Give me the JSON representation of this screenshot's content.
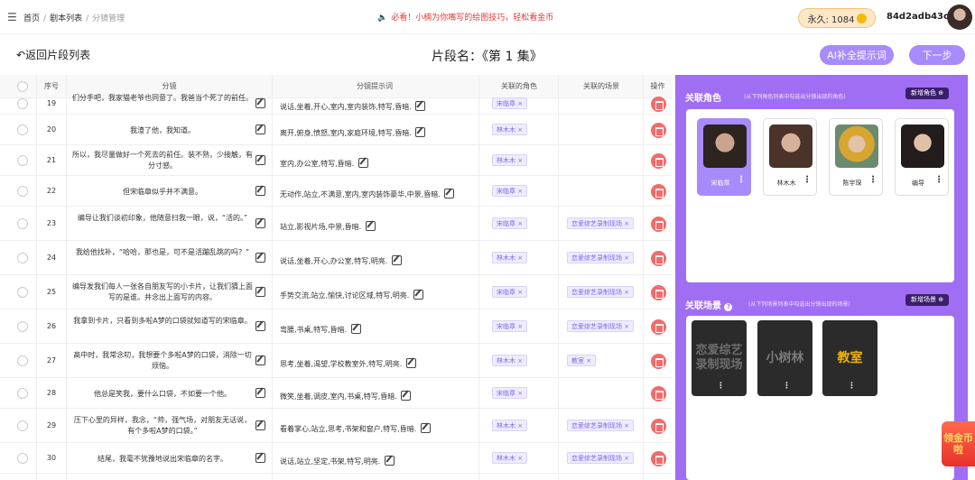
{
  "topbar": {
    "breadcrumbs": [
      "首页",
      "剧本列表",
      "分镜管理"
    ],
    "notice": "必看！小楠为你嘴写的绘图技巧，轻松看金币",
    "coins_label": "永久: 1084",
    "username": "84d2adb43c26"
  },
  "header": {
    "back_label": "返回片段列表",
    "episode_title": "片段名：《第 1 集》",
    "ai_button": "AI补全提示词",
    "next_button": "下一步"
  },
  "table": {
    "columns": [
      "序号",
      "分镜",
      "分镜提示词",
      "关联的角色",
      "关联的场景",
      "操作"
    ],
    "rows": [
      {
        "no": "19",
        "shot": "们分手吧，我家猫老爷也同意了。我爸当个死了的前任。",
        "prompt": "说话,坐着,开心,室内,室内装饰,特写,昏暗.",
        "role": "宋临章 ×",
        "scene": ""
      },
      {
        "no": "20",
        "shot": "我渣了他，我知道。",
        "prompt": "离开,俯身,愤怒,室内,家庭环境,特写,昏暗.",
        "role": "林木木 ×",
        "scene": ""
      },
      {
        "no": "21",
        "shot": "所以，我尽量做好一个死去的前任。装不熟，少接触，有分寸感。",
        "prompt": "室内,办公室,特写,昏暗.",
        "role": "林木木 ×",
        "scene": ""
      },
      {
        "no": "22",
        "shot": "但宋临章似乎并不满意。",
        "prompt": "无动作,站立,不满意,室内,室内装饰豪华,中景,昏暗.",
        "role": "宋临章 ×",
        "scene": ""
      },
      {
        "no": "23",
        "shot": "编导让我们谈初印象，他随意扫我一眼，说，“活的。”",
        "prompt": "站立,影视片场,中景,昏暗.",
        "role": "宋临章 ×",
        "scene": "恋爱综艺录制现场 ×"
      },
      {
        "no": "24",
        "shot": "我给他找补，“哈哈，那也是，可不是活蹦乱跳的吗？”",
        "prompt": "说话,坐着,开心,办公室,特写,明亮.",
        "role": "林木木 ×",
        "scene": "恋爱综艺录制现场 ×"
      },
      {
        "no": "25",
        "shot": "编导发我们每人一张各自朋友写的小卡片，让我们猜上面写的是谁。并念出上面写的内容。",
        "prompt": "手势交流,站立,愉快,讨论区域,特写,明亮.",
        "role": "宋临章 ×",
        "scene": "恋爱综艺录制现场 ×"
      },
      {
        "no": "26",
        "shot": "我拿到卡片，只看到多啦A梦的口袋就知道写的宋临章。",
        "prompt": "弯腰,书桌,特写,昏暗.",
        "role": "宋临章 ×",
        "scene": "恋爱综艺录制现场 ×"
      },
      {
        "no": "27",
        "shot": "高中时，我常念叨，我想要个多啦A梦的口袋，消除一切烦恼。",
        "prompt": "思考,坐着,渴望,学校教室外,特写,明亮.",
        "role": "林木木 ×",
        "scene": "教室 ×"
      },
      {
        "no": "28",
        "shot": "他总是笑我，要什么口袋，不如要一个他。",
        "prompt": "微笑,坐着,调皮,室内,书桌,特写,昏暗.",
        "role": "宋临章 ×",
        "scene": ""
      },
      {
        "no": "29",
        "shot": "压下心里的异样，我念，“帅，强气场，对朋友无话说，有个多啦A梦的口袋。”",
        "prompt": "看着掌心,站立,思考,书架和窗户,特写,昏暗.",
        "role": "林木木 ×",
        "scene": "恋爱综艺录制现场 ×"
      },
      {
        "no": "30",
        "shot": "结尾，我毫不犹豫地说出宋临章的名字。",
        "prompt": "说话,站立,坚定,书架,特写,明亮.",
        "role": "林木木 ×",
        "scene": "恋爱综艺录制现场 ×"
      }
    ]
  },
  "roles_panel": {
    "title": "关联角色",
    "subtitle": "(从下列角色列表中勾选出分镜出现的角色)",
    "add_button": "新增角色 ⊕",
    "characters": [
      {
        "name": "宋临章"
      },
      {
        "name": "林木木"
      },
      {
        "name": "陈宇琛"
      },
      {
        "name": "编导"
      }
    ]
  },
  "scenes_panel": {
    "title": "关联场景",
    "subtitle": "(从下列场景列表中勾选出分镜出现的场景)",
    "add_button": "新增场景 ⊕",
    "scenes": [
      {
        "name": "恋爱综艺录制现场"
      },
      {
        "name": "小树林"
      },
      {
        "name": "教室"
      }
    ]
  },
  "float_badge": "领金币啦",
  "colors": {
    "accent": "#a78bfa",
    "panel": "#a06ef2",
    "danger": "#f56a6a",
    "notice": "#e03b3b"
  }
}
